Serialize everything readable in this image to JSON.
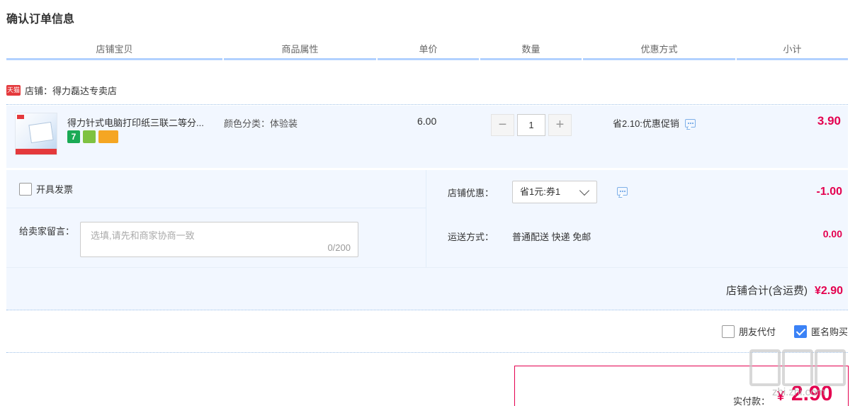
{
  "page_title": "确认订单信息",
  "columns": [
    "店铺宝贝",
    "商品属性",
    "单价",
    "数量",
    "优惠方式",
    "小计"
  ],
  "shop": {
    "badge": "天猫",
    "label": "店铺：得力磊达专卖店"
  },
  "item": {
    "title": "得力针式电脑打印纸三联二等分...",
    "badges": [
      "7",
      "",
      ""
    ],
    "attr": "颜色分类：体验装",
    "unit_price": "6.00",
    "quantity": "1",
    "minus": "−",
    "plus": "+",
    "promo": "省2.10:优惠促销",
    "subtotal": "3.90"
  },
  "invoice": {
    "label": "开具发票"
  },
  "message": {
    "label": "给卖家留言：",
    "placeholder": "选填,请先和商家协商一致",
    "counter": "0/200"
  },
  "shop_discount": {
    "label": "店铺优惠：",
    "selected": "省1元:券1",
    "amount": "-1.00"
  },
  "shipping": {
    "label": "运送方式：",
    "value": "普通配送 快递 免邮",
    "amount": "0.00"
  },
  "shop_total": {
    "label": "店铺合计(含运费)",
    "value": "¥2.90"
  },
  "options": {
    "friend_pay": "朋友代付",
    "anonymous": "匿名购买"
  },
  "pay": {
    "label": "实付款：",
    "symbol": "¥",
    "amount": "2.90"
  },
  "watermark": "zhi.zhi.com",
  "colors": {
    "accent": "#e4004f",
    "header_line": "#b2d1ff",
    "row_bg": "#f2f7ff",
    "check": "#3b82f6"
  }
}
